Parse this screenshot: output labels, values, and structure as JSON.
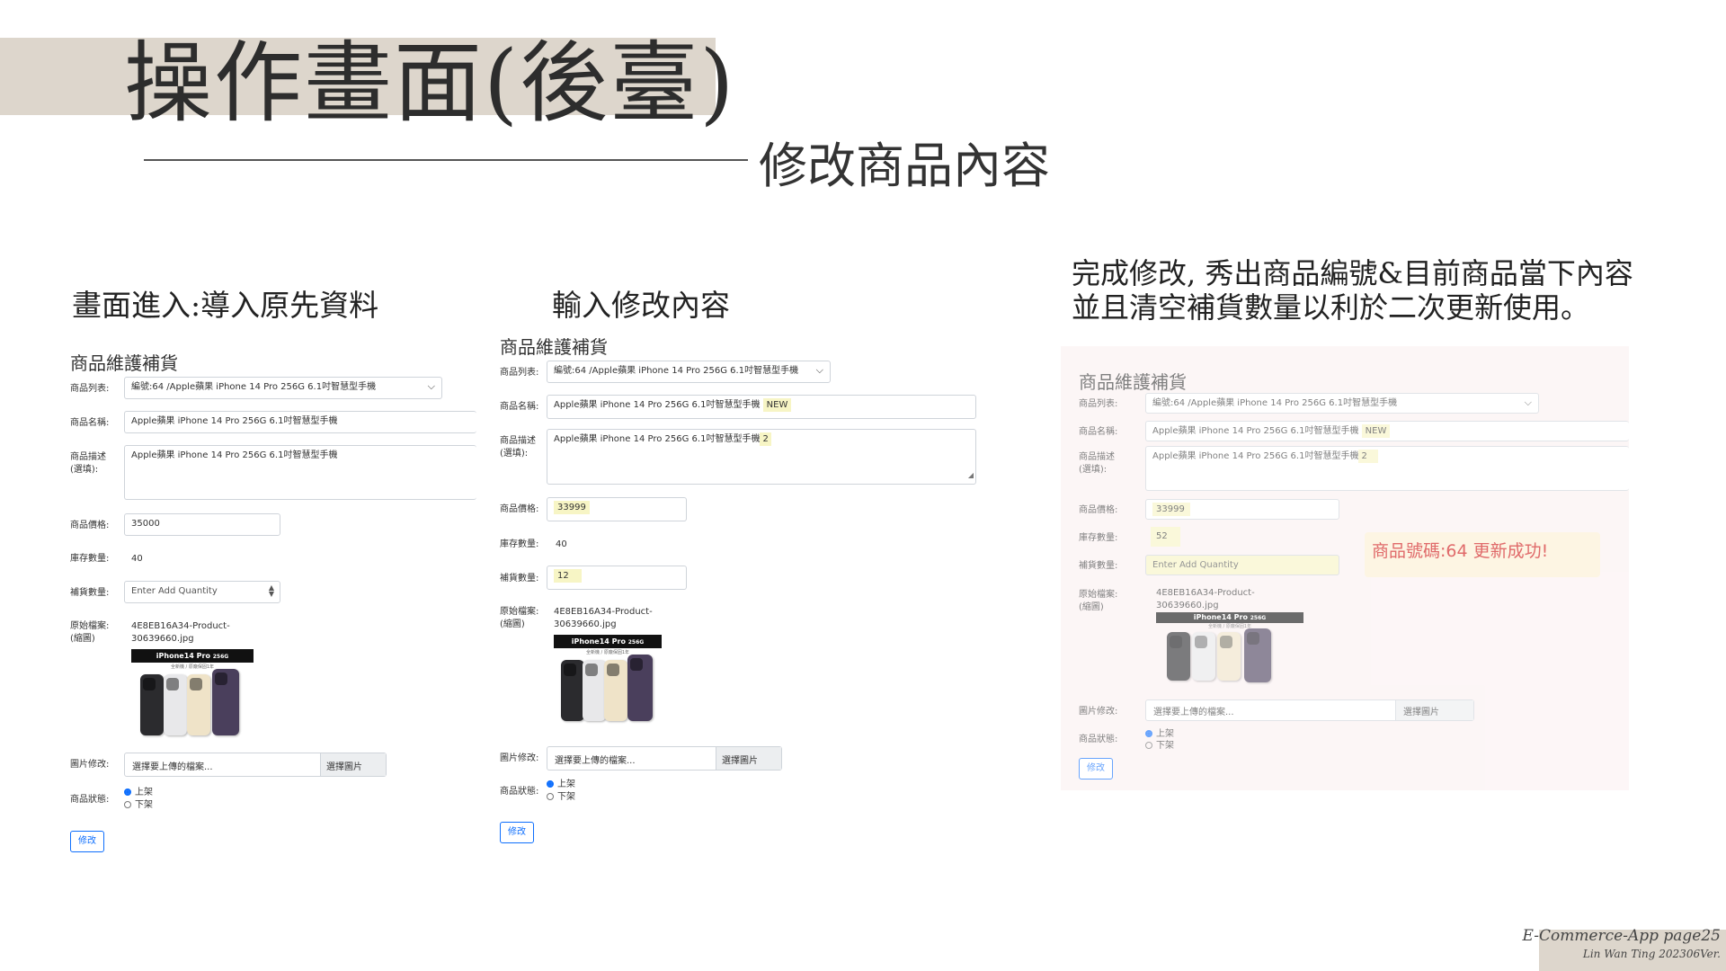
{
  "slide": {
    "title": "操作畫面(後臺)",
    "subtitle": "修改商品內容",
    "footer_line1": "E-Commerce-App page25",
    "footer_line2": "Lin Wan Ting 202306Ver."
  },
  "captions": {
    "panel1": "畫面進入:導入原先資料",
    "panel2": "輸入修改內容",
    "panel3_line1": "完成修改, 秀出商品編號&目前商品當下內容",
    "panel3_line2": "並且清空補貨數量以利於二次更新使用。"
  },
  "form_labels": {
    "heading": "商品維護補貨",
    "product_list": "商品列表:",
    "product_name": "商品名稱:",
    "product_desc_1": "商品描述",
    "product_desc_2": "(選填):",
    "price": "商品價格:",
    "stock": "庫存數量:",
    "restock": "補貨數量:",
    "orig_file_1": "原始檔案:",
    "orig_file_2": "(縮圖)",
    "image_edit": "圖片修改:",
    "status": "商品狀態:",
    "file_placeholder": "選擇要上傳的檔案...",
    "file_button": "選擇圖片",
    "radio_on": "上架",
    "radio_off": "下架",
    "submit": "修改",
    "restock_placeholder": "Enter Add Quantity"
  },
  "product_image": {
    "banner": "iPhone14 Pro",
    "banner_badge": "256G",
    "sub": "全新機 / 原廠保固1年"
  },
  "panel1": {
    "selected_product": "編號:64 /Apple蘋果 iPhone 14 Pro 256G 6.1吋智慧型手機",
    "name": "Apple蘋果 iPhone 14 Pro 256G 6.1吋智慧型手機",
    "desc": "Apple蘋果 iPhone 14 Pro 256G 6.1吋智慧型手機",
    "price": "35000",
    "stock": "40",
    "filename_1": "4E8EB16A34-Product-",
    "filename_2": "30639660.jpg"
  },
  "panel2": {
    "selected_product": "編號:64 /Apple蘋果 iPhone 14 Pro 256G 6.1吋智慧型手機",
    "name": "Apple蘋果 iPhone 14 Pro 256G 6.1吋智慧型手機",
    "name_added": "NEW",
    "desc": "Apple蘋果 iPhone 14 Pro 256G 6.1吋智慧型手機",
    "desc_added": "2",
    "price": "33999",
    "stock": "40",
    "restock": "12",
    "filename_1": "4E8EB16A34-Product-",
    "filename_2": "30639660.jpg"
  },
  "panel3": {
    "selected_product": "編號:64 /Apple蘋果 iPhone 14 Pro 256G 6.1吋智慧型手機",
    "name": "Apple蘋果 iPhone 14 Pro 256G 6.1吋智慧型手機",
    "name_added": "NEW",
    "desc": "Apple蘋果 iPhone 14 Pro 256G 6.1吋智慧型手機",
    "desc_added": "2",
    "price": "33999",
    "stock": "52",
    "filename_1": "4E8EB16A34-Product-",
    "filename_2": "30639660.jpg",
    "success_message": "商品號碼:64 更新成功!"
  },
  "colors": {
    "band": "#ddd6cc",
    "primary_blue": "#0d6efd",
    "highlight": "#f7f5c5",
    "success_text": "#e06a6a",
    "phone_black": "#2b2b2e",
    "phone_silver": "#e8e8ea",
    "phone_gold": "#efe3c8",
    "phone_purple": "#4a3f5c"
  }
}
